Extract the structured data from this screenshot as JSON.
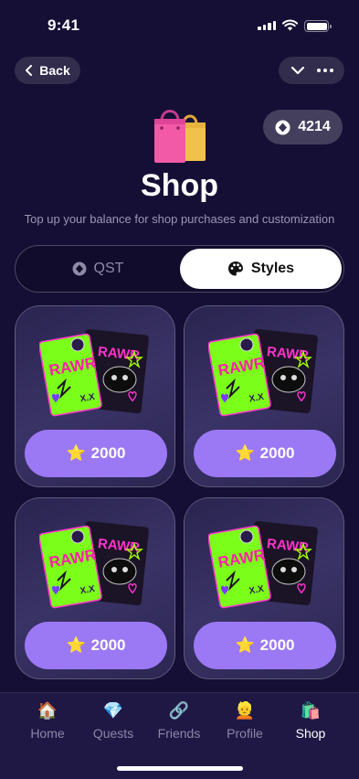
{
  "status_bar": {
    "time": "9:41"
  },
  "header": {
    "back_label": "Back"
  },
  "balance": {
    "amount": "4214"
  },
  "page": {
    "title": "Shop",
    "subtitle": "Top up your balance for shop purchases and customization"
  },
  "tabs": [
    {
      "label": "QST",
      "active": false
    },
    {
      "label": "Styles",
      "active": true
    }
  ],
  "products": [
    {
      "price": "2000",
      "art_text": "RAWR"
    },
    {
      "price": "2000",
      "art_text": "RAWR"
    },
    {
      "price": "2000",
      "art_text": "RAWR"
    },
    {
      "price": "2000",
      "art_text": "RAWR"
    }
  ],
  "bottom_nav": [
    {
      "label": "Home",
      "icon": "house-icon",
      "active": false
    },
    {
      "label": "Quests",
      "icon": "diamond-icon",
      "active": false
    },
    {
      "label": "Friends",
      "icon": "link-icon",
      "active": false
    },
    {
      "label": "Profile",
      "icon": "person-icon",
      "active": false
    },
    {
      "label": "Shop",
      "icon": "shopping-bags-icon",
      "active": true
    }
  ],
  "colors": {
    "background": "#160f35",
    "price_button": "#9b78f4",
    "nav_background": "#1f1845"
  }
}
